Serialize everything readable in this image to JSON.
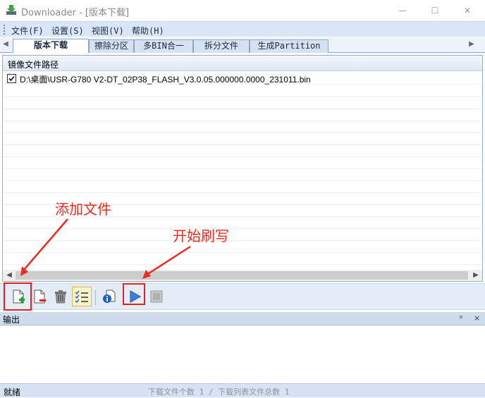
{
  "window": {
    "title": "Downloader - [版本下载]",
    "controls": {
      "minimize": "—",
      "maximize": "☐",
      "close": "✕"
    }
  },
  "menu": {
    "items": [
      "文件(F)",
      "设置(S)",
      "视图(V)",
      "帮助(H)"
    ]
  },
  "tabs": {
    "items": [
      "版本下载",
      "擦除分区",
      "多BIN合一",
      "拆分文件",
      "生成Partition"
    ],
    "active_index": 0
  },
  "file_list": {
    "column_header": "镜像文件路径",
    "rows": [
      {
        "checked": true,
        "path": "D:\\桌面\\USR-G780 V2-DT_02P38_FLASH_V3.0.05.000000.0000_231011.bin"
      }
    ]
  },
  "toolbar": {
    "buttons": [
      {
        "icon": "add-file-icon"
      },
      {
        "icon": "remove-file-icon"
      },
      {
        "icon": "trash-icon"
      },
      {
        "icon": "checklist-icon"
      },
      {
        "icon": "file-info-icon"
      },
      {
        "icon": "play-icon"
      },
      {
        "icon": "stop-icon"
      }
    ]
  },
  "annotations": {
    "add_file": "添加文件",
    "start_flash": "开始刷写",
    "color": "#ee2b1e"
  },
  "output": {
    "title": "输出",
    "pin": "ᵖ",
    "close": "×"
  },
  "status": {
    "state": "就绪",
    "counts": "下载文件个数 1 / 下载列表文件总数 1"
  }
}
